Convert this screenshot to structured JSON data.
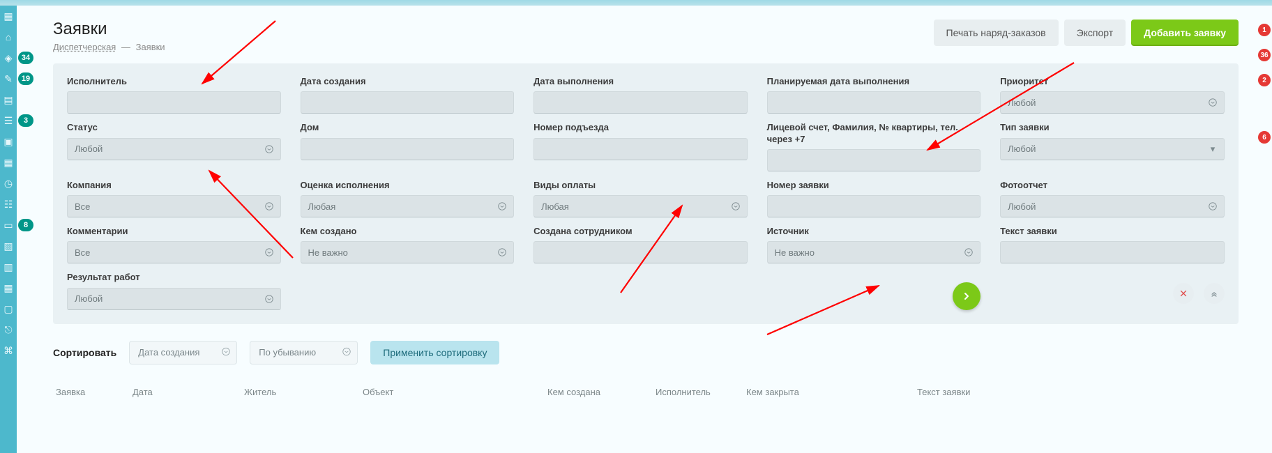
{
  "header": {
    "title": "Заявки",
    "breadcrumb_root": "Диспетчерская",
    "breadcrumb_current": "Заявки",
    "btn_print": "Печать наряд-заказов",
    "btn_export": "Экспорт",
    "btn_add": "Добавить заявку"
  },
  "rail_badges": [
    "34",
    "19",
    "3",
    "8"
  ],
  "right_badges": [
    "1",
    "36",
    "2",
    "6"
  ],
  "filters": {
    "executor_lbl": "Исполнитель",
    "created_lbl": "Дата создания",
    "done_lbl": "Дата выполнения",
    "plan_lbl": "Планируемая дата выполнения",
    "priority_lbl": "Приоритет",
    "priority_val": "Любой",
    "status_lbl": "Статус",
    "status_val": "Любой",
    "house_lbl": "Дом",
    "entrance_lbl": "Номер подъезда",
    "account_lbl": "Лицевой счет, Фамилия, № квартиры, тел. через +7",
    "type_lbl": "Тип заявки",
    "type_val": "Любой",
    "company_lbl": "Компания",
    "company_val": "Все",
    "rating_lbl": "Оценка исполнения",
    "rating_val": "Любая",
    "paykind_lbl": "Виды оплаты",
    "paykind_val": "Любая",
    "reqnum_lbl": "Номер заявки",
    "photo_lbl": "Фотоотчет",
    "photo_val": "Любой",
    "comments_lbl": "Комментарии",
    "comments_val": "Все",
    "createdby_lbl": "Кем создано",
    "createdby_val": "Не важно",
    "empcreated_lbl": "Создана сотрудником",
    "source_lbl": "Источник",
    "source_val": "Не важно",
    "text_lbl": "Текст заявки",
    "result_lbl": "Результат работ",
    "result_val": "Любой"
  },
  "sort": {
    "label": "Сортировать",
    "field": "Дата создания",
    "dir": "По убыванию",
    "apply": "Применить сортировку"
  },
  "columns": {
    "c1": "Заявка",
    "c2": "Дата",
    "c3": "Житель",
    "c4": "Объект",
    "c5": "Кем создана",
    "c6": "Исполнитель",
    "c7": "Кем закрыта",
    "c8": "Текст заявки"
  }
}
